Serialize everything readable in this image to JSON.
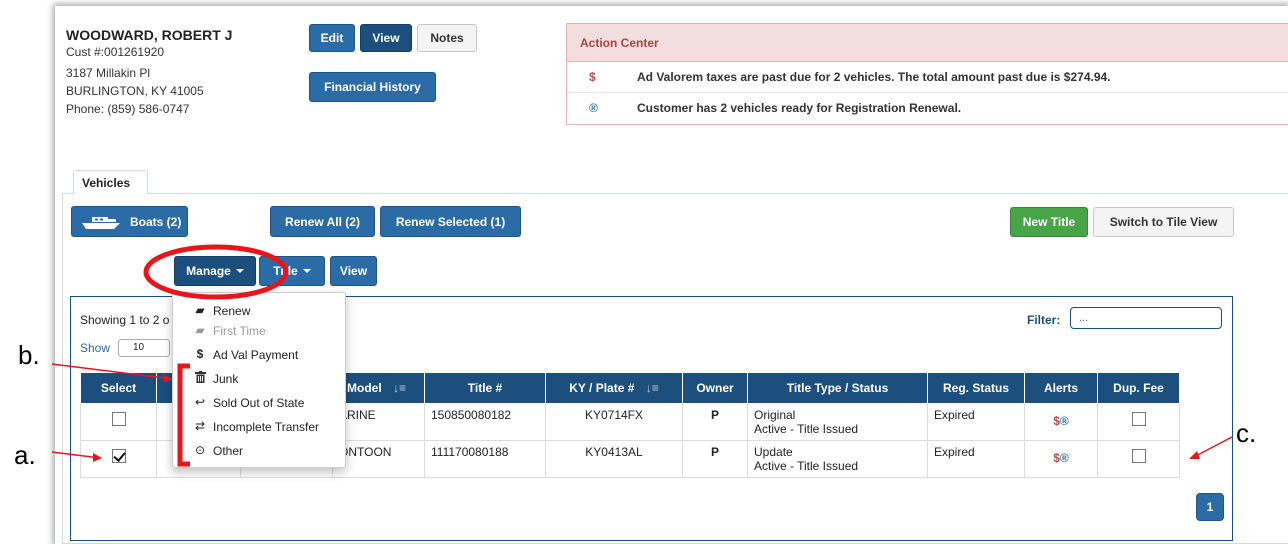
{
  "customer": {
    "name": "WOODWARD, ROBERT J",
    "cust_no": "Cust #:001261920",
    "address1": "3187 Millakin Pl",
    "address2": "BURLINGTON, KY 41005",
    "phone": "Phone: (859) 586-0747"
  },
  "header_buttons": {
    "edit": "Edit",
    "view": "View",
    "notes": "Notes",
    "financial_history": "Financial History"
  },
  "action_center": {
    "title": "Action Center",
    "items": [
      {
        "icon": "$",
        "text": "Ad Valorem taxes are past due for 2 vehicles. The total amount past due is $274.94."
      },
      {
        "icon": "®",
        "text": "Customer has 2 vehicles ready for Registration Renewal."
      }
    ]
  },
  "tabs": {
    "vehicles": "Vehicles"
  },
  "toolbar": {
    "boats": "Boats (2)",
    "renew_all": "Renew All (2)",
    "renew_selected": "Renew Selected (1)",
    "new_title": "New Title",
    "switch_tile": "Switch to Tile View",
    "manage": "Manage",
    "title": "Title",
    "view": "View"
  },
  "table_controls": {
    "showing": "Showing 1 to 2 o",
    "show_label": "Show",
    "show_value": "10",
    "filter_label": "Filter:",
    "filter_placeholder": "..."
  },
  "manage_menu": [
    {
      "icon": "book-icon",
      "glyph": "▰",
      "label": "Renew",
      "disabled": false
    },
    {
      "icon": "book-icon",
      "glyph": "▰",
      "label": "First Time",
      "disabled": true
    },
    {
      "icon": "dollar-icon",
      "glyph": "$",
      "label": "Ad Val Payment",
      "disabled": false
    },
    {
      "icon": "trash-icon",
      "glyph": "🗑",
      "label": "Junk",
      "disabled": false
    },
    {
      "icon": "reply-icon",
      "glyph": "↩",
      "label": "Sold Out of State",
      "disabled": false
    },
    {
      "icon": "transfer-icon",
      "glyph": "⇄",
      "label": "Incomplete Transfer",
      "disabled": false
    },
    {
      "icon": "circle-dot-icon",
      "glyph": "⊙",
      "label": "Other",
      "disabled": false
    }
  ],
  "table": {
    "headers": [
      "Select",
      "",
      "",
      "Model",
      "Title #",
      "KY / Plate #",
      "Owner",
      "Title Type / Status",
      "Reg. Status",
      "Alerts",
      "Dup. Fee"
    ],
    "rows": [
      {
        "selected": false,
        "model": "ARINE",
        "title_no": "150850080182",
        "plate": "KY0714FX",
        "owner": "P",
        "title_type": "Original",
        "title_status": "Active - Title Issued",
        "reg_status": "Expired",
        "alert_dollar": "$",
        "alert_reg": "®",
        "dup_fee": false
      },
      {
        "selected": true,
        "model": "ONTOON",
        "title_no": "111170080188",
        "plate": "KY0413AL",
        "owner": "P",
        "title_type": "Update",
        "title_status": "Active - Title Issued",
        "reg_status": "Expired",
        "alert_dollar": "$",
        "alert_reg": "®",
        "dup_fee": false
      }
    ]
  },
  "pagination": {
    "page": "1"
  },
  "callouts": {
    "a": "a.",
    "b": "b.",
    "c": "c."
  },
  "colors": {
    "primary": "#2b6ca6",
    "dark": "#1d4f7e",
    "green": "#47a447",
    "alert_red": "#a94442",
    "annotation_red": "#e8161b"
  }
}
